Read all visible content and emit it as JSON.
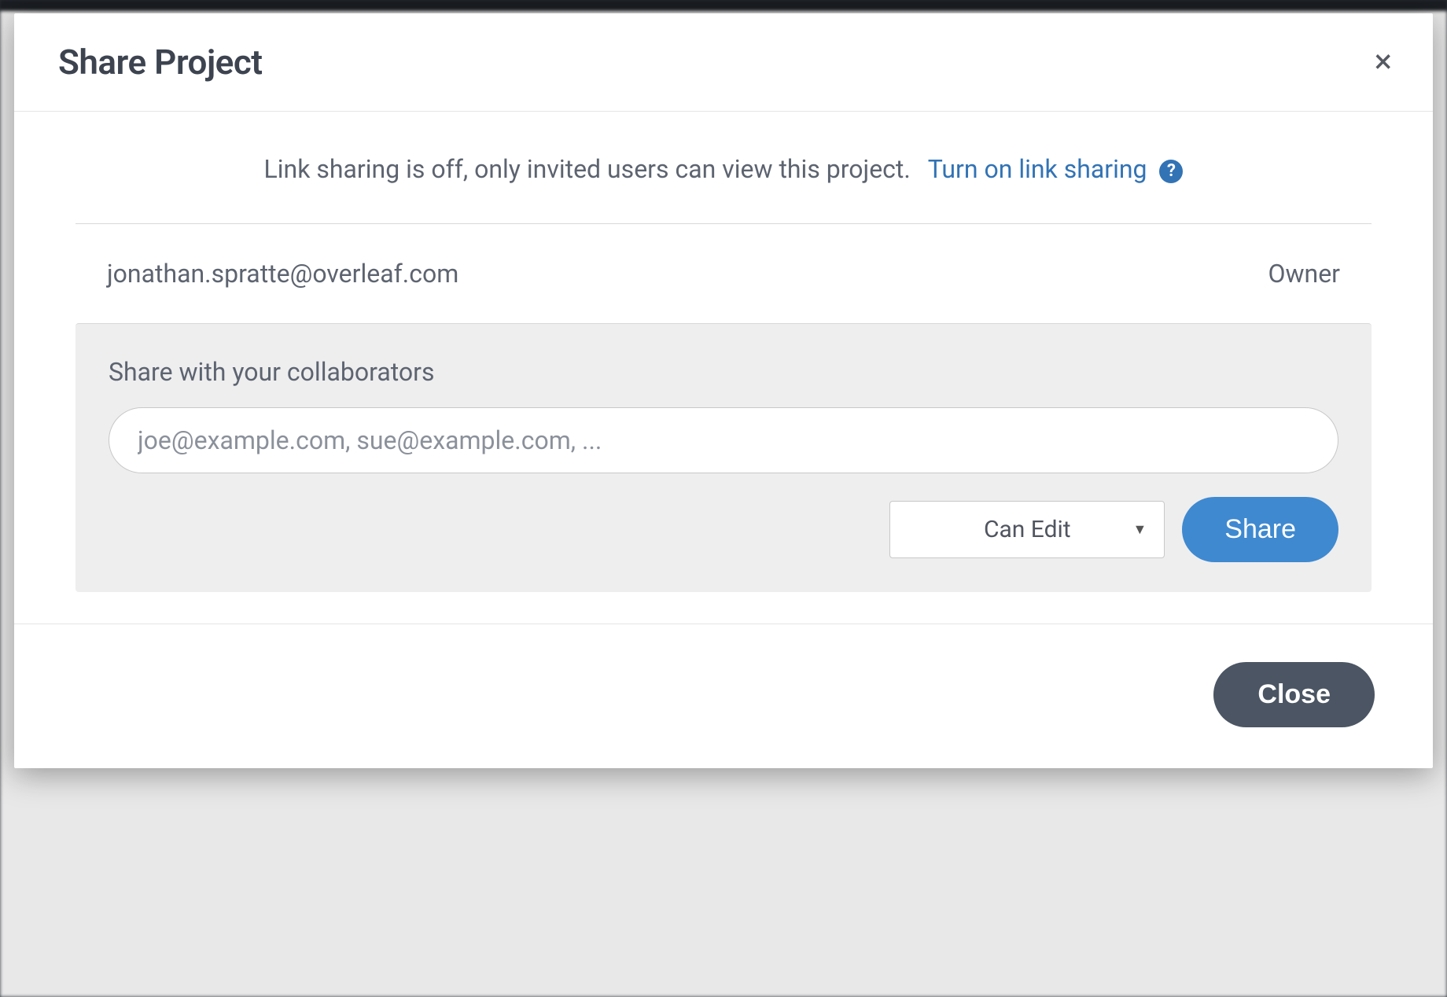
{
  "modal": {
    "title": "Share Project",
    "link_sharing": {
      "status_text": "Link sharing is off, only invited users can view this project.",
      "action_text": "Turn on link sharing",
      "help_symbol": "?"
    },
    "owner": {
      "email": "jonathan.spratte@overleaf.com",
      "role": "Owner"
    },
    "share_section": {
      "label": "Share with your collaborators",
      "input_placeholder": "joe@example.com, sue@example.com, ...",
      "permission_selected": "Can Edit",
      "share_button": "Share"
    },
    "footer": {
      "close_button": "Close"
    },
    "close_x": "×"
  }
}
